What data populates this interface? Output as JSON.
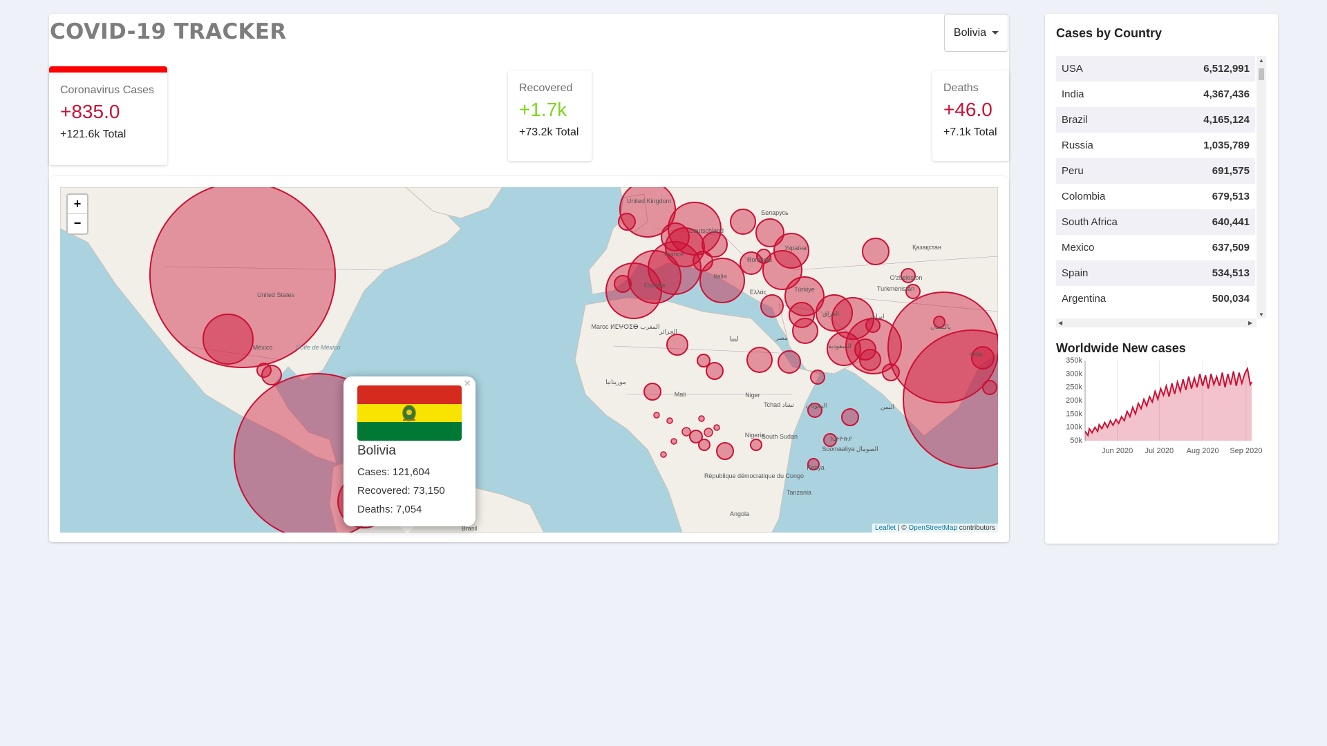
{
  "app_title": "COVID-19 TRACKER",
  "country_select": {
    "value": "Bolivia"
  },
  "stats": {
    "cases": {
      "label": "Coronavirus Cases",
      "value": "+835.0",
      "total": "+121.6k Total",
      "color": "#cc1034"
    },
    "recovered": {
      "label": "Recovered",
      "value": "+1.7k",
      "total": "+73.2k Total",
      "color": "#7dd71d"
    },
    "deaths": {
      "label": "Deaths",
      "value": "+46.0",
      "total": "+7.1k Total",
      "color": "#cc1034"
    }
  },
  "map": {
    "zoom_in": "+",
    "zoom_out": "−",
    "attribution": {
      "leaflet": "Leaflet",
      "separator": " | © ",
      "osm": "OpenStreetMap",
      "suffix": " contributors"
    },
    "circle_color": "#cc1034",
    "place_labels": [
      "United Kingdom",
      "Беларусь",
      "Deutschland",
      "Україна",
      "France",
      "România",
      "Қазақстан",
      "Italia",
      "España",
      "Ελλάς",
      "Türkiye",
      "O'zbekiston",
      "Turkmenistan",
      "United States",
      "México",
      "Golfe de México",
      "Maroc ⵍⵎⵖⵔⵉⴱ المغرب",
      "الجزائر",
      "ليبيا",
      "مصر",
      "العراق",
      "ایران",
      "السعودية",
      "پاکستان",
      "India",
      "Mali",
      "Niger",
      "Tchad تشاد",
      "السودان",
      "اليمن",
      "Nigeria",
      "South Sudan",
      "ኢትዮጵያ",
      "Soomaaliya الصومال",
      "République démocratique du Congo",
      "Kenya",
      "Tanzania",
      "Angola",
      "Brasil",
      "موريتانيا"
    ]
  },
  "popup": {
    "close": "×",
    "country": "Bolivia",
    "cases": "Cases: 121,604",
    "recovered": "Recovered: 73,150",
    "deaths": "Deaths: 7,054",
    "flag_colors": [
      "#d52b1e",
      "#f9e300",
      "#007934"
    ]
  },
  "sidebar": {
    "title": "Cases by Country",
    "countries": [
      {
        "name": "USA",
        "cases": "6,512,991"
      },
      {
        "name": "India",
        "cases": "4,367,436"
      },
      {
        "name": "Brazil",
        "cases": "4,165,124"
      },
      {
        "name": "Russia",
        "cases": "1,035,789"
      },
      {
        "name": "Peru",
        "cases": "691,575"
      },
      {
        "name": "Colombia",
        "cases": "679,513"
      },
      {
        "name": "South Africa",
        "cases": "640,441"
      },
      {
        "name": "Mexico",
        "cases": "637,509"
      },
      {
        "name": "Spain",
        "cases": "534,513"
      },
      {
        "name": "Argentina",
        "cases": "500,034"
      }
    ]
  },
  "chart_title": "Worldwide New cases",
  "chart_data": {
    "type": "area",
    "title": "Worldwide New cases",
    "xlabel": "",
    "ylabel": "",
    "ylim": [
      50000,
      350000
    ],
    "y_ticks": [
      "350k",
      "300k",
      "250k",
      "200k",
      "150k",
      "100k",
      "50k"
    ],
    "x_ticks": [
      "Jun 2020",
      "Jul 2020",
      "Aug 2020",
      "Sep 2020"
    ],
    "x_tick_days": [
      23,
      53,
      84,
      115
    ],
    "line_color": "#cc1034",
    "fill_color": "rgba(204,16,52,0.25)",
    "x_days": [
      0,
      2,
      3,
      5,
      7,
      9,
      10,
      12,
      14,
      16,
      18,
      20,
      22,
      24,
      26,
      28,
      30,
      32,
      34,
      36,
      38,
      40,
      42,
      44,
      46,
      48,
      50,
      52,
      54,
      56,
      58,
      60,
      62,
      64,
      66,
      68,
      70,
      72,
      74,
      76,
      78,
      80,
      82,
      84,
      86,
      88,
      90,
      92,
      94,
      96,
      98,
      100,
      102,
      104,
      106,
      108,
      110,
      112,
      114,
      116,
      118,
      119
    ],
    "values": [
      85000,
      70000,
      95000,
      80000,
      100000,
      85000,
      110000,
      95000,
      118000,
      100000,
      125000,
      108000,
      130000,
      115000,
      140000,
      125000,
      160000,
      140000,
      175000,
      150000,
      190000,
      170000,
      205000,
      180000,
      215000,
      195000,
      235000,
      205000,
      245000,
      220000,
      255000,
      215000,
      265000,
      225000,
      270000,
      235000,
      280000,
      240000,
      290000,
      245000,
      285000,
      250000,
      300000,
      255000,
      295000,
      245000,
      300000,
      260000,
      290000,
      255000,
      305000,
      250000,
      300000,
      260000,
      310000,
      255000,
      305000,
      265000,
      300000,
      320000,
      260000,
      270000
    ]
  }
}
